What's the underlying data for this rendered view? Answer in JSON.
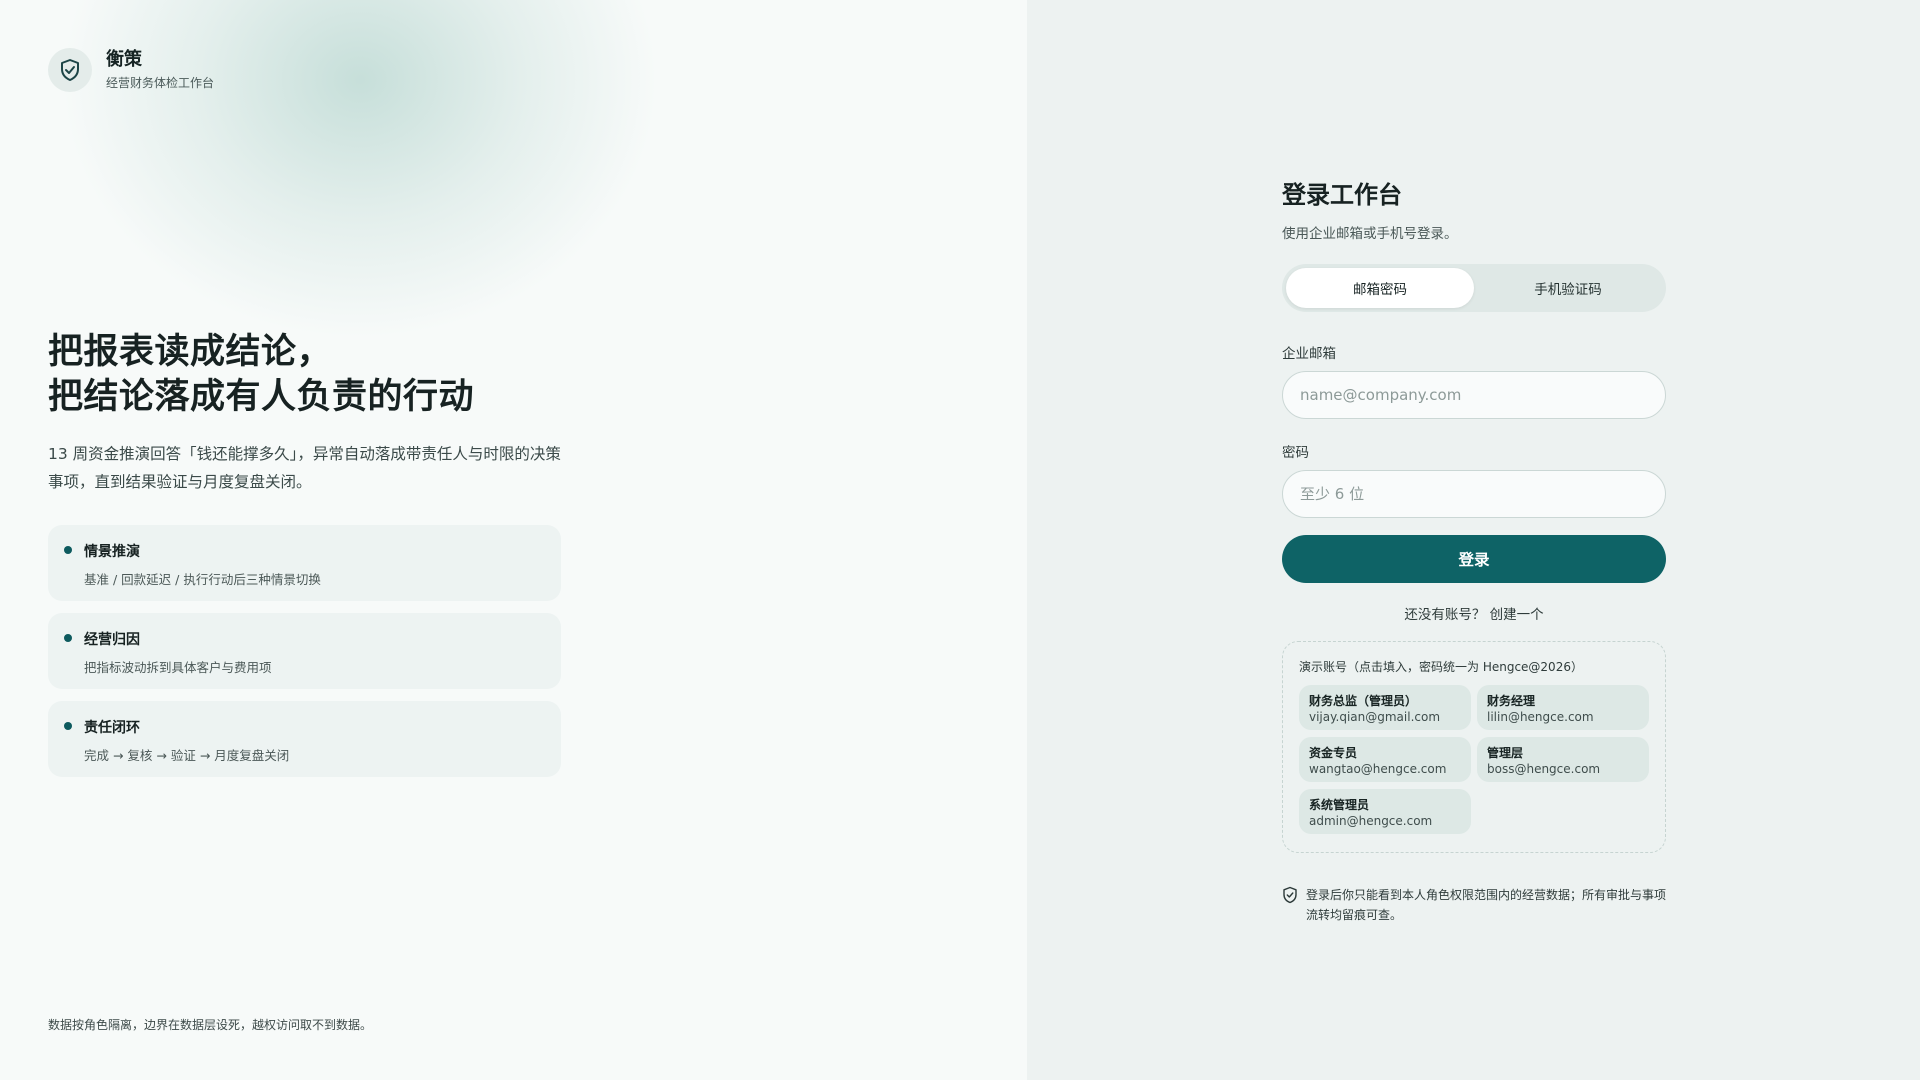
{
  "brand": {
    "name": "衡策",
    "subtitle": "经营财务体检工作台"
  },
  "hero": {
    "title_line1": "把报表读成结论，",
    "title_line2": "把结论落成有人负责的行动",
    "description": "13 周资金推演回答「钱还能撑多久」，异常自动落成带责任人与时限的决策事项，直到结果验证与月度复盘关闭。"
  },
  "features": [
    {
      "title": "情景推演",
      "desc": "基准 / 回款延迟 / 执行行动后三种情景切换"
    },
    {
      "title": "经营归因",
      "desc": "把指标波动拆到具体客户与费用项"
    },
    {
      "title": "责任闭环",
      "desc": "完成 → 复核 → 验证 → 月度复盘关闭"
    }
  ],
  "footer_note": "数据按角色隔离，边界在数据层设死，越权访问取不到数据。",
  "login": {
    "title": "登录工作台",
    "subtitle": "使用企业邮箱或手机号登录。",
    "tabs": [
      {
        "label": "邮箱密码",
        "active": true
      },
      {
        "label": "手机验证码",
        "active": false
      }
    ],
    "email_label": "企业邮箱",
    "email_placeholder": "name@company.com",
    "password_label": "密码",
    "password_placeholder": "至少 6 位",
    "submit_label": "登录",
    "register_prompt": "还没有账号？",
    "register_link": "创建一个"
  },
  "demo": {
    "title": "演示账号（点击填入，密码统一为 Hengce@2026）",
    "accounts": [
      {
        "role": "财务总监（管理员）",
        "email": "vijay.qian@gmail.com"
      },
      {
        "role": "财务经理",
        "email": "lilin@hengce.com"
      },
      {
        "role": "资金专员",
        "email": "wangtao@hengce.com"
      },
      {
        "role": "管理层",
        "email": "boss@hengce.com"
      },
      {
        "role": "系统管理员",
        "email": "admin@hengce.com"
      }
    ]
  },
  "notice": "登录后你只能看到本人角色权限范围内的经营数据；所有审批与事项流转均留痕可查。",
  "colors": {
    "accent": "#0e6366",
    "left_bg": "#f7faf9",
    "right_bg": "#edf2f1"
  }
}
